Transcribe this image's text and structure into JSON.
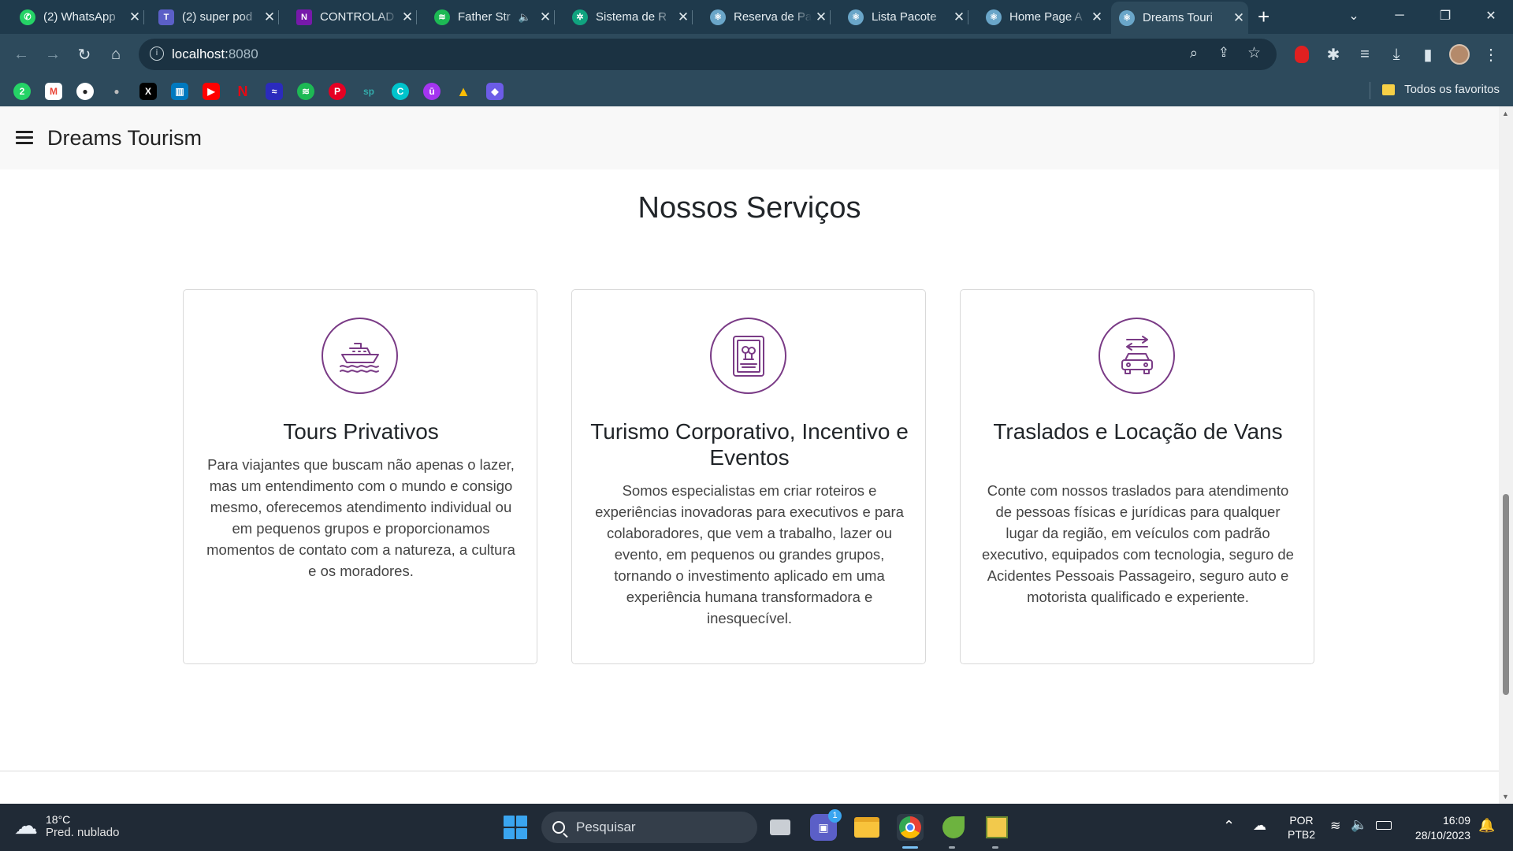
{
  "browser": {
    "tabs": [
      {
        "title": "(2) WhatsApp",
        "fav": "whatsapp-icon",
        "color": "#25d366",
        "glyph": "✆"
      },
      {
        "title": "(2) super pod",
        "fav": "teams-icon",
        "color": "#5b5fc7",
        "glyph": "T"
      },
      {
        "title": "CONTROLAD",
        "fav": "onenote-icon",
        "color": "#7719aa",
        "glyph": "N"
      },
      {
        "title": "Father Str",
        "fav": "spotify-icon",
        "color": "#1db954",
        "glyph": "≋"
      },
      {
        "title": "Sistema de R",
        "fav": "chatgpt-icon",
        "color": "#10a37f",
        "glyph": "✲"
      },
      {
        "title": "Reserva de Pa",
        "fav": "react-icon",
        "color": "#6aa6c9",
        "glyph": "⚛"
      },
      {
        "title": "Lista Pacote",
        "fav": "react-icon",
        "color": "#6aa6c9",
        "glyph": "⚛"
      },
      {
        "title": "Home Page A",
        "fav": "react-icon",
        "color": "#6aa6c9",
        "glyph": "⚛"
      },
      {
        "title": "Dreams Touri",
        "fav": "react-icon",
        "color": "#6aa6c9",
        "glyph": "⚛"
      }
    ],
    "url_host": "localhost:",
    "url_port": "8080",
    "bookmarks_folder": "Todos os favoritos"
  },
  "site": {
    "brand": "Dreams Tourism",
    "section_title": "Nossos Serviços",
    "services": [
      {
        "title": "Tours Privativos",
        "icon": "ship-icon",
        "text": "Para viajantes que buscam não apenas o lazer, mas um entendimento com o mundo e consigo mesmo, oferecemos atendimento individual ou em pequenos grupos e proporcionamos momentos de contato com a natureza, a cultura e os moradores."
      },
      {
        "title": "Turismo Corporativo, Incentivo e Eventos",
        "icon": "certificate-icon",
        "text": "Somos especialistas em criar roteiros e experiências inovadoras para executivos e para colaboradores, que vem a trabalho, lazer ou evento, em pequenos ou grandes grupos, tornando o investimento aplicado em uma experiência humana transformadora e inesquecível."
      },
      {
        "title": "Traslados e Locação de Vans",
        "icon": "car-transfer-icon",
        "text": "Conte com nossos traslados para atendimento de pessoas físicas e jurídicas para qualquer lugar da região, em veículos com padrão executivo, equipados com tecnologia, seguro de Acidentes Pessoais Passageiro, seguro auto e motorista qualificado e experiente."
      }
    ],
    "accent_color": "#7a3b86"
  },
  "taskbar": {
    "temperature": "18°C",
    "condition": "Pred. nublado",
    "search_placeholder": "Pesquisar",
    "chat_badge": "1",
    "lang": "POR",
    "layout": "PTB2",
    "time": "16:09",
    "date": "28/10/2023"
  }
}
